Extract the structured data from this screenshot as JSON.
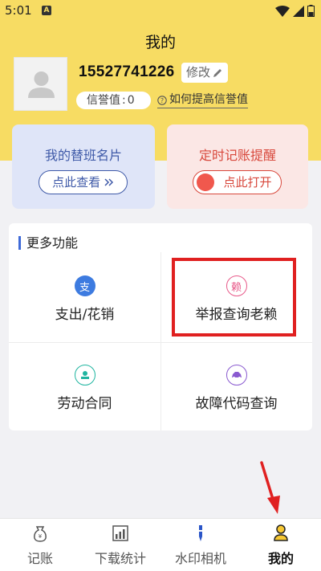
{
  "status_bar": {
    "time": "5:01",
    "notification_letter": "A"
  },
  "header": {
    "title": "我的",
    "phone": "15527741226",
    "edit_label": "修改",
    "credit_label": "信誉值",
    "credit_value": "0",
    "improve_link": "如何提高信誉值"
  },
  "cards": {
    "left": {
      "title": "我的替班名片",
      "button": "点此查看"
    },
    "right": {
      "title": "定时记账提醒",
      "button": "点此打开"
    }
  },
  "more": {
    "title": "更多功能",
    "items": [
      {
        "label": "支出/花销",
        "icon_glyph": "支",
        "icon_color": "#3d7be0"
      },
      {
        "label": "举报查询老赖",
        "icon_glyph": "赖",
        "icon_color": "#e85a8a"
      },
      {
        "label": "劳动合同",
        "icon_glyph": "",
        "icon_color": "#1fb5a0"
      },
      {
        "label": "故障代码查询",
        "icon_glyph": "",
        "icon_color": "#8a5ad0"
      }
    ]
  },
  "bottom_nav": [
    {
      "label": "记账",
      "icon": "moneybag-icon"
    },
    {
      "label": "下载统计",
      "icon": "chart-icon"
    },
    {
      "label": "水印相机",
      "icon": "pen-icon"
    },
    {
      "label": "我的",
      "icon": "user-icon",
      "active": true
    }
  ],
  "colors": {
    "brand_yellow": "#f7dc63",
    "highlight_red": "#e02020",
    "blue": "#3f5aa8",
    "red": "#d8483c"
  }
}
